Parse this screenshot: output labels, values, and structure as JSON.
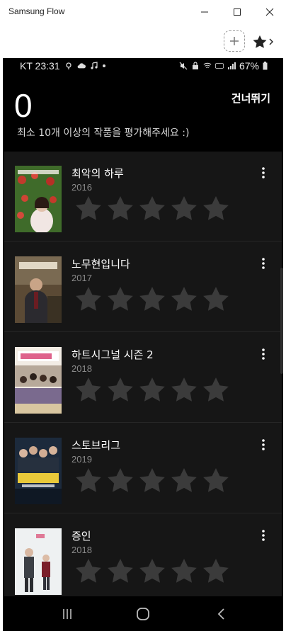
{
  "window": {
    "title": "Samsung Flow"
  },
  "status_bar": {
    "carrier_time": "KT 23:31",
    "battery": "67%"
  },
  "header": {
    "count": "0",
    "skip_label": "건너뛰기",
    "instruction": "최소 10개 이상의 작품을 평가해주세요 :)"
  },
  "movies": [
    {
      "title": "최악의 하루",
      "year": "2016",
      "rating": 0
    },
    {
      "title": "노무현입니다",
      "year": "2017",
      "rating": 0
    },
    {
      "title": "하트시그널 시즌 2",
      "year": "2018",
      "rating": 0
    },
    {
      "title": "스토브리그",
      "year": "2019",
      "rating": 0
    },
    {
      "title": "증인",
      "year": "2018",
      "rating": 0
    }
  ],
  "colors": {
    "background": "#000000",
    "list_bg": "#161616",
    "star_empty": "#3b3b3b"
  }
}
